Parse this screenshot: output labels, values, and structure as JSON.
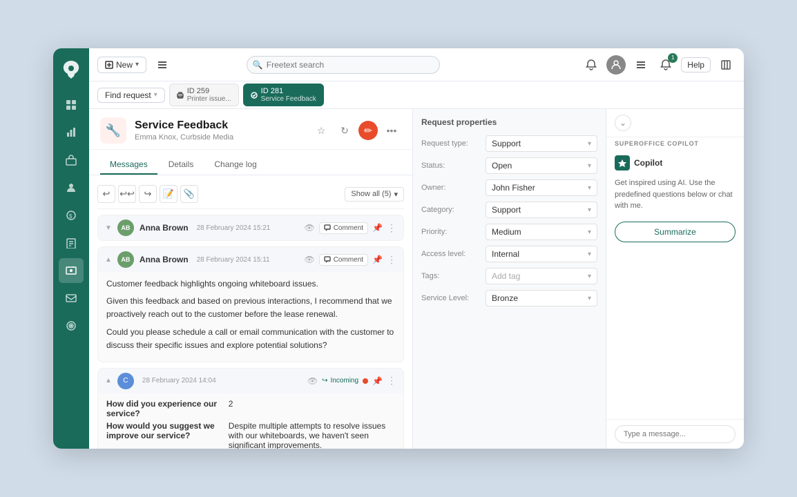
{
  "topbar": {
    "new_label": "New",
    "search_placeholder": "Freetext search",
    "help_label": "Help",
    "notif_count": "1"
  },
  "tabs": {
    "find_request": "Find request",
    "tab1": {
      "id": "ID 259",
      "subtitle": "Printer issue..."
    },
    "tab2": {
      "id": "ID 281",
      "subtitle": "Service Feedback",
      "active": true
    }
  },
  "request": {
    "title": "Service Feedback",
    "subtitle": "Emma Knox, Curbside Media",
    "icon": "🔧"
  },
  "tab_nav": {
    "messages": "Messages",
    "details": "Details",
    "change_log": "Change log"
  },
  "messages": {
    "show_all_label": "Show all (5)",
    "message1": {
      "sender": "Anna Brown",
      "initials": "AB",
      "date": "28 February 2024 15:21",
      "type": "Comment",
      "avatar_color": "#6b9e6b"
    },
    "message2": {
      "sender": "Anna Brown",
      "initials": "AB",
      "date": "28 February 2024 15:11",
      "type": "Comment",
      "avatar_color": "#6b9e6b",
      "body_p1": "Customer feedback highlights ongoing whiteboard issues.",
      "body_p2": "Given this feedback and based on previous interactions, I recommend that we proactively reach out to the customer before the lease renewal.",
      "body_p3": "Could you please schedule a call or email communication with the customer to discuss their specific issues and explore potential solutions?"
    },
    "message3": {
      "date": "28 February 2024 14:04",
      "incoming_label": "Incoming",
      "avatar_color": "#5b8dd9",
      "survey": {
        "q1": "How did you experience our service?",
        "a1": "2",
        "q2": "How would you suggest we improve our service?",
        "a2": "Despite multiple attempts to resolve issues with our whiteboards, we haven't seen significant improvements."
      }
    }
  },
  "properties": {
    "title": "Request properties",
    "request_type_label": "Request type:",
    "request_type_value": "Support",
    "status_label": "Status:",
    "status_value": "Open",
    "owner_label": "Owner:",
    "owner_value": "John Fisher",
    "category_label": "Category:",
    "category_value": "Support",
    "priority_label": "Priority:",
    "priority_value": "Medium",
    "access_label": "Access level:",
    "access_value": "Internal",
    "tags_label": "Tags:",
    "tags_value": "Add tag",
    "service_label": "Service Level:",
    "service_value": "Bronze"
  },
  "copilot": {
    "section_title": "SUPEROFFICE COPILOT",
    "logo_label": "Copilot",
    "description": "Get inspired using AI. Use the predefined questions below or chat with me.",
    "summarize_label": "Summarize",
    "input_placeholder": "Type a message..."
  },
  "sidebar": {
    "icons": [
      "🏠",
      "📊",
      "🏢",
      "👤",
      "💰",
      "📋",
      "👥",
      "📧",
      "🎯"
    ]
  }
}
